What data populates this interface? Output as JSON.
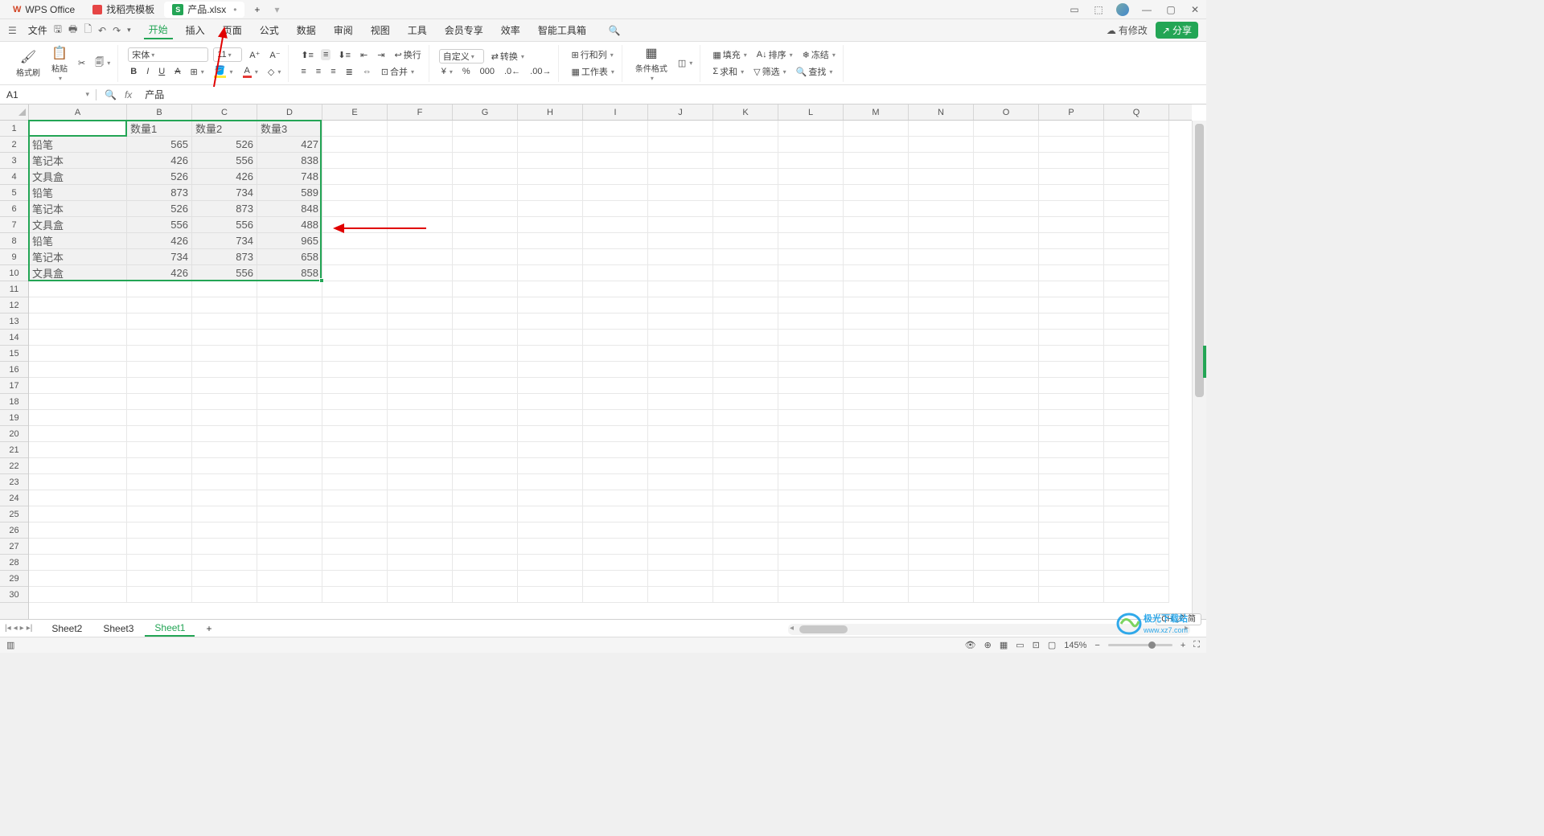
{
  "title_bar": {
    "app_name": "WPS Office",
    "template_tab": "找稻壳模板",
    "doc_tab": "产品.xlsx",
    "doc_modified": "•",
    "add_tab": "+"
  },
  "menu": {
    "file": "文件",
    "items": [
      "开始",
      "插入",
      "页面",
      "公式",
      "数据",
      "审阅",
      "视图",
      "工具",
      "会员专享",
      "效率",
      "智能工具箱"
    ],
    "modified": "有修改",
    "share": "分享"
  },
  "ribbon": {
    "format_painter": "格式刷",
    "paste": "粘贴",
    "font_name": "宋体",
    "font_size": "11",
    "wrap": "换行",
    "merge": "合并",
    "number_fmt": "自定义",
    "convert": "转换",
    "rowcol": "行和列",
    "worksheet": "工作表",
    "cond_fmt": "条件格式",
    "fill": "填充",
    "sort": "排序",
    "freeze": "冻结",
    "sum": "求和",
    "filter": "筛选",
    "find": "查找"
  },
  "formula_bar": {
    "cell_ref": "A1",
    "content": "产品"
  },
  "columns": [
    "A",
    "B",
    "C",
    "D",
    "E",
    "F",
    "G",
    "H",
    "I",
    "J",
    "K",
    "L",
    "M",
    "N",
    "O",
    "P",
    "Q"
  ],
  "row_count": 30,
  "table": {
    "headers": [
      "产品",
      "数量1",
      "数量2",
      "数量3"
    ],
    "rows": [
      [
        "铅笔",
        "565",
        "526",
        "427"
      ],
      [
        "笔记本",
        "426",
        "556",
        "838"
      ],
      [
        "文具盒",
        "526",
        "426",
        "748"
      ],
      [
        "铅笔",
        "873",
        "734",
        "589"
      ],
      [
        "笔记本",
        "526",
        "873",
        "848"
      ],
      [
        "文具盒",
        "556",
        "556",
        "488"
      ],
      [
        "铅笔",
        "426",
        "734",
        "965"
      ],
      [
        "笔记本",
        "734",
        "873",
        "658"
      ],
      [
        "文具盒",
        "426",
        "556",
        "858"
      ]
    ]
  },
  "sheets": {
    "tabs": [
      "Sheet2",
      "Sheet3",
      "Sheet1"
    ],
    "active": "Sheet1"
  },
  "ime": {
    "lang": "CH",
    "mode": "简"
  },
  "status": {
    "zoom": "145%"
  },
  "watermark": {
    "l1": "极光下载站",
    "l2": "www.xz7.com"
  }
}
